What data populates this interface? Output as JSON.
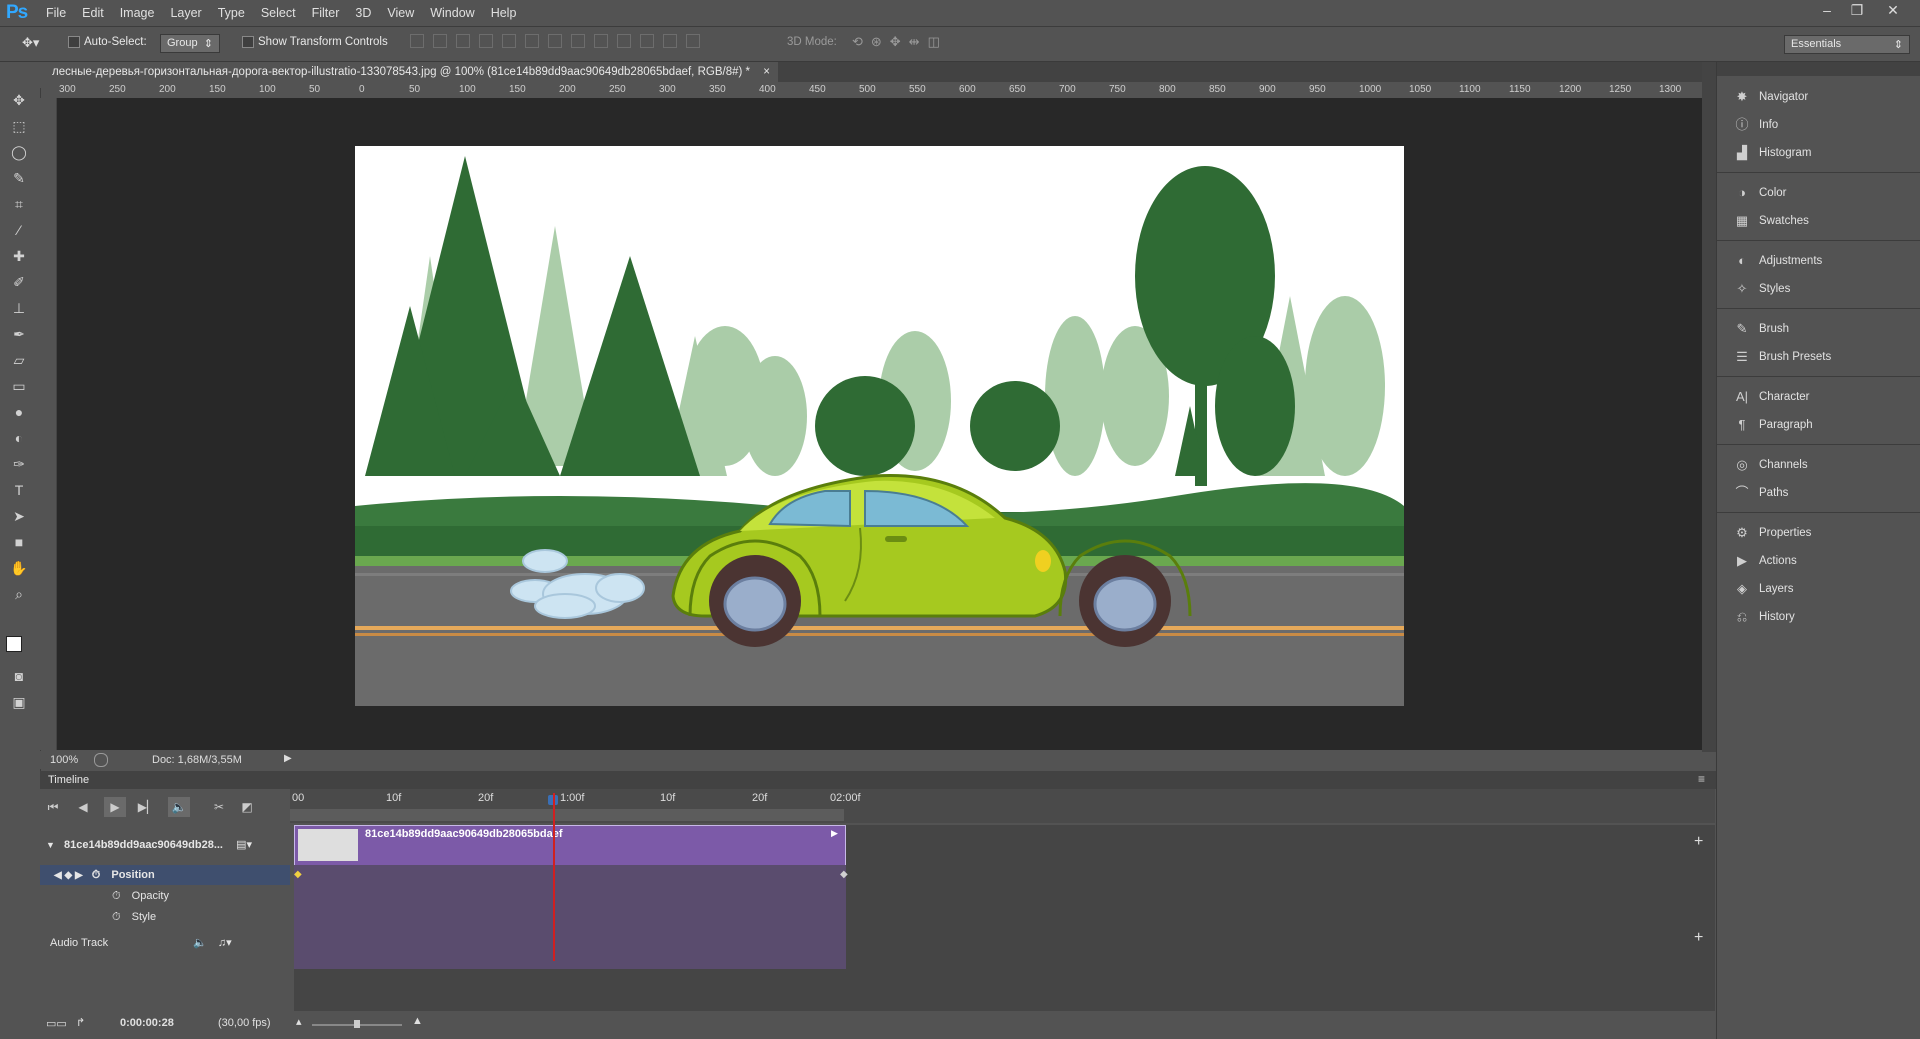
{
  "app": {
    "logo": "Ps"
  },
  "menu": [
    "File",
    "Edit",
    "Image",
    "Layer",
    "Type",
    "Select",
    "Filter",
    "3D",
    "View",
    "Window",
    "Help"
  ],
  "window_controls": {
    "minimize": "–",
    "restore": "❐",
    "close": "✕"
  },
  "options": {
    "auto_select_label": "Auto-Select:",
    "auto_select_value": "Group",
    "show_transform_label": "Show Transform Controls",
    "mode_3d_label": "3D Mode:",
    "workspace": "Essentials"
  },
  "document": {
    "tab_title": "лесные-деревья-горизонтальная-дорога-вектор-illustratio-133078543.jpg @ 100% (81ce14b89dd9aac90649db28065bdaef, RGB/8#) *",
    "close": "×"
  },
  "ruler": {
    "ticks": [
      "300",
      "250",
      "200",
      "150",
      "100",
      "50",
      "0",
      "50",
      "100",
      "150",
      "200",
      "250",
      "300",
      "350",
      "400",
      "450",
      "500",
      "550",
      "600",
      "650",
      "700",
      "750",
      "800",
      "850",
      "900",
      "950",
      "1000",
      "1050",
      "1100",
      "1150",
      "1200",
      "1250",
      "1300"
    ]
  },
  "status": {
    "zoom": "100%",
    "doc": "Doc: 1,68M/3,55M"
  },
  "timeline": {
    "title": "Timeline",
    "ruler_labels": [
      "00",
      "10f",
      "20f",
      "1:00f",
      "10f",
      "20f",
      "02:00f"
    ],
    "layer_name": "81ce14b89dd9aac90649db28...",
    "clip_name": "81ce14b89dd9aac90649db28065bdaef",
    "properties": [
      "Position",
      "Opacity",
      "Style"
    ],
    "audio_track": "Audio Track",
    "current_time": "0:00:00:28",
    "fps": "(30,00 fps)",
    "add": "+"
  },
  "panels": [
    {
      "label": "Navigator",
      "icon": "navigator-icon"
    },
    {
      "label": "Info",
      "icon": "info-icon"
    },
    {
      "label": "Histogram",
      "icon": "histogram-icon"
    },
    {
      "label": "Color",
      "icon": "color-icon"
    },
    {
      "label": "Swatches",
      "icon": "swatches-icon"
    },
    {
      "label": "Adjustments",
      "icon": "adjustments-icon"
    },
    {
      "label": "Styles",
      "icon": "styles-icon"
    },
    {
      "label": "Brush",
      "icon": "brush-icon"
    },
    {
      "label": "Brush Presets",
      "icon": "brush-presets-icon"
    },
    {
      "label": "Character",
      "icon": "character-icon"
    },
    {
      "label": "Paragraph",
      "icon": "paragraph-icon"
    },
    {
      "label": "Channels",
      "icon": "channels-icon"
    },
    {
      "label": "Paths",
      "icon": "paths-icon"
    },
    {
      "label": "Properties",
      "icon": "properties-icon"
    },
    {
      "label": "Actions",
      "icon": "actions-icon"
    },
    {
      "label": "Layers",
      "icon": "layers-icon"
    },
    {
      "label": "History",
      "icon": "history-icon"
    }
  ],
  "colors": {
    "accent": "#31a8ff",
    "clip": "#7c5aa8",
    "playhead": "#d02020",
    "keyframe": "#f0d040"
  }
}
